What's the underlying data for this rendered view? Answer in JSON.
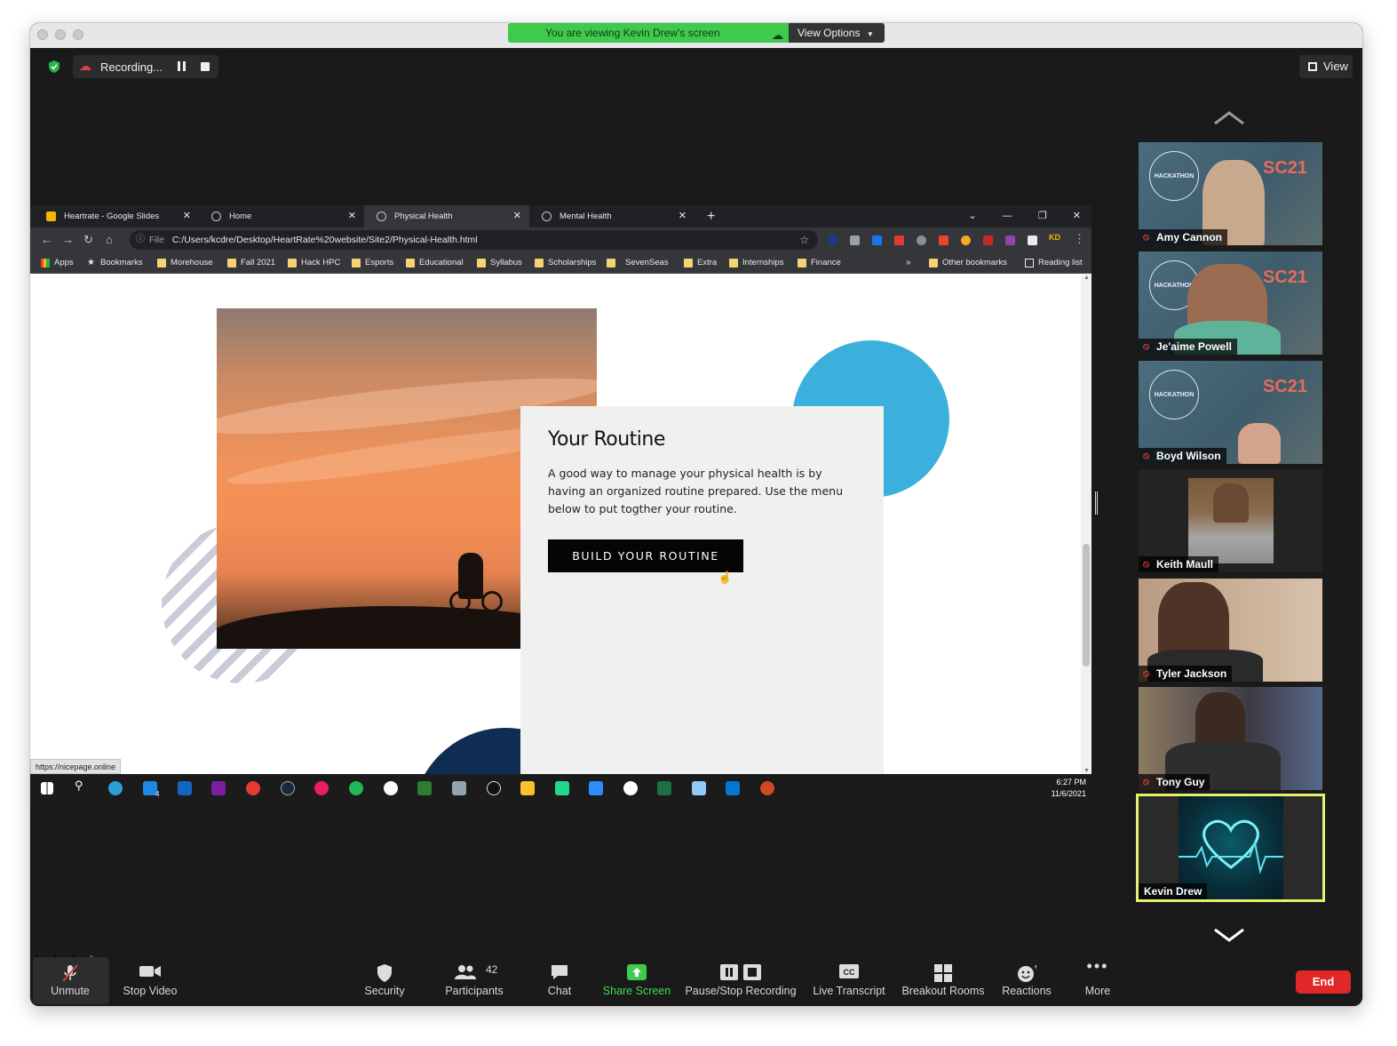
{
  "meeting": {
    "viewing_banner": "You are viewing Kevin Drew's screen",
    "view_options": "View Options",
    "recording_label": "Recording...",
    "view_button": "View"
  },
  "browser": {
    "tabs": [
      {
        "label": "Heartrate - Google Slides",
        "icon": "slides-icon"
      },
      {
        "label": "Home",
        "icon": "globe-icon"
      },
      {
        "label": "Physical Health",
        "icon": "globe-icon"
      },
      {
        "label": "Mental Health",
        "icon": "globe-icon"
      }
    ],
    "active_tab": 2,
    "url_scheme": "File",
    "url": "C:/Users/kcdre/Desktop/HeartRate%20website/Site2/Physical-Health.html",
    "profile_initials": "KD",
    "bookmarks": [
      "Apps",
      "Bookmarks",
      "Morehouse",
      "Fall 2021",
      "Hack HPC",
      "Esports",
      "Educational",
      "Syllabus",
      "Scholarships",
      "SevenSeas",
      "Extra",
      "Internships",
      "Finance"
    ],
    "bookmarks_more": "»",
    "other_bookmarks": "Other bookmarks",
    "reading_list": "Reading list",
    "status_url": "https://nicepage.online"
  },
  "page": {
    "heading": "Your Routine",
    "body": "A good way to manage your physical health is by having an organized routine prepared. Use the menu below to put togther your routine.",
    "cta": "BUILD YOUR ROUTINE"
  },
  "taskbar": {
    "time": "6:27 PM",
    "date": "11/6/2021",
    "mail_badge": "4"
  },
  "participants_panel": [
    {
      "name": "Amy Cannon",
      "muted": true
    },
    {
      "name": "Je'aime Powell",
      "muted": true
    },
    {
      "name": "Boyd Wilson",
      "muted": true
    },
    {
      "name": "Keith Maull",
      "muted": true
    },
    {
      "name": "Tyler Jackson",
      "muted": true
    },
    {
      "name": "Tony Guy",
      "muted": true
    },
    {
      "name": "Kevin Drew",
      "muted": false,
      "active_speaker": true
    }
  ],
  "banner_text": {
    "hpc": "HPC",
    "city": "City",
    "hackathon": "HACKATHON",
    "sc21": "SC21"
  },
  "toolbar": {
    "unmute": "Unmute",
    "stop_video": "Stop Video",
    "security": "Security",
    "participants": "Participants",
    "participants_count": "42",
    "chat": "Chat",
    "share_screen": "Share Screen",
    "pause_stop_recording": "Pause/Stop Recording",
    "live_transcript": "Live Transcript",
    "breakout_rooms": "Breakout Rooms",
    "reactions": "Reactions",
    "more": "More",
    "end": "End"
  },
  "colors": {
    "share_green": "#3fc94d",
    "end_red": "#e02828",
    "active_speaker_border": "#e6f06a",
    "accent_blue": "#3bb0dc",
    "accent_navy": "#0f2d52"
  }
}
